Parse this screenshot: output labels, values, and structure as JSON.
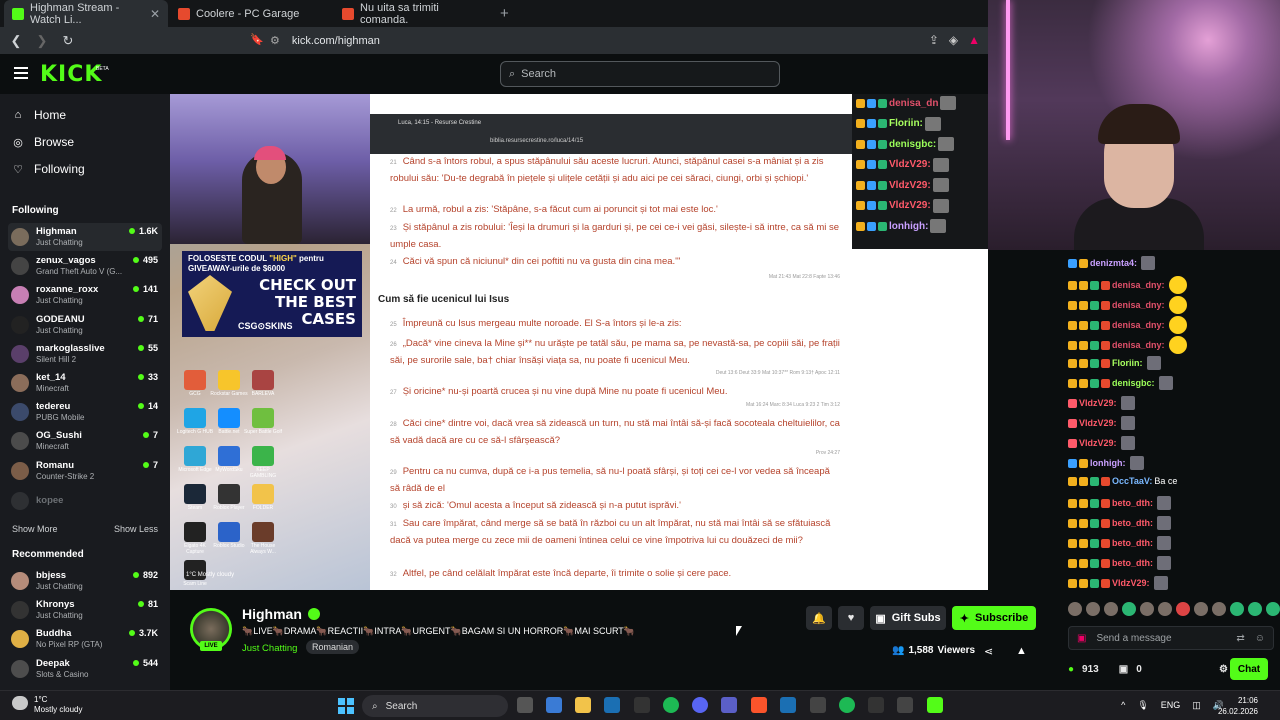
{
  "browser": {
    "tabs": [
      {
        "title": "Highman Stream - Watch Li...",
        "favicon_color": "#53fc18"
      },
      {
        "title": "Coolere - PC Garage",
        "favicon_color": "#e64a2e"
      },
      {
        "title": "Nu uita sa trimiti comanda.",
        "favicon_color": "#e64a2e"
      }
    ],
    "url": "kick.com/highman"
  },
  "kick": {
    "logo": "KICK",
    "beta": "BETA",
    "search_placeholder": "Search"
  },
  "sidebar": {
    "nav": [
      {
        "label": "Home",
        "icon": "home-icon"
      },
      {
        "label": "Browse",
        "icon": "compass-icon"
      },
      {
        "label": "Following",
        "icon": "heart-icon"
      }
    ],
    "following_title": "Following",
    "following": [
      {
        "name": "Highman",
        "game": "Just Chatting",
        "viewers": "1.6K",
        "color": "#7a6c5c"
      },
      {
        "name": "zenux_vagos",
        "game": "Grand Theft Auto V (G...",
        "viewers": "495",
        "color": "#444"
      },
      {
        "name": "roxanne_roxx",
        "game": "Just Chatting",
        "viewers": "141",
        "color": "#c77fb4"
      },
      {
        "name": "GODEANU",
        "game": "Just Chatting",
        "viewers": "71",
        "color": "#222"
      },
      {
        "name": "markoglasslive",
        "game": "Silent Hill 2",
        "viewers": "55",
        "color": "#5a3f6a"
      },
      {
        "name": "ket_14",
        "game": "Minecraft",
        "viewers": "33",
        "color": "#8b6d5a"
      },
      {
        "name": "tedereu",
        "game": "PUBG Mobile",
        "viewers": "14",
        "color": "#3b4a6b"
      },
      {
        "name": "OG_Sushi",
        "game": "Minecraft",
        "viewers": "7",
        "color": "#4b4b4b"
      },
      {
        "name": "Romanu",
        "game": "Counter-Strike 2",
        "viewers": "7",
        "color": "#7b5d48"
      }
    ],
    "offline": "kopee",
    "show_more": "Show More",
    "show_less": "Show Less",
    "recommended_title": "Recommended",
    "recommended": [
      {
        "name": "bbjess",
        "game": "Just Chatting",
        "viewers": "892",
        "color": "#b58c7a"
      },
      {
        "name": "Khronys",
        "game": "Just Chatting",
        "viewers": "81",
        "color": "#333"
      },
      {
        "name": "Buddha",
        "game": "No Pixel RP (GTA)",
        "viewers": "3.7K",
        "color": "#e0b045"
      },
      {
        "name": "Deepak",
        "game": "Slots & Casino",
        "viewers": "544",
        "color": "#4d4d4d"
      }
    ]
  },
  "player": {
    "promo": {
      "line1": "FOLOSESTE CODUL ",
      "code": "\"HIGH\"",
      "line1b": " pentru",
      "line2": "GIVEAWAY-urile de $6000",
      "cta": "CHECK OUT THE BEST CASES",
      "brand": "CSG⊙SKINS"
    },
    "desktop_icons": [
      {
        "label": "GCG",
        "color": "#e25d3a"
      },
      {
        "label": "Rockstar Games",
        "color": "#f7c52b"
      },
      {
        "label": "BARLEVA",
        "color": "#a94442"
      },
      {
        "label": "Logitech G HUB",
        "color": "#1fa5e5"
      },
      {
        "label": "Battle.net",
        "color": "#148eff"
      },
      {
        "label": "Super Battle Golf",
        "color": "#6fbf3f"
      },
      {
        "label": "Microsoft Edge",
        "color": "#2fa7d6"
      },
      {
        "label": "MyWordSku",
        "color": "#2f6fd6"
      },
      {
        "label": "KEEP GAMBLING",
        "color": "#3bb44a"
      },
      {
        "label": "Steam",
        "color": "#1b2838"
      },
      {
        "label": "Roblox Player",
        "color": "#333"
      },
      {
        "label": "FOLDER",
        "color": "#f2c34a"
      },
      {
        "label": "Elgato 4K Capture",
        "color": "#222"
      },
      {
        "label": "Roblox Studio",
        "color": "#2b63c9"
      },
      {
        "label": "The House Always W...",
        "color": "#6a3c2a"
      },
      {
        "label": "Scam Line",
        "color": "#222"
      }
    ],
    "desktop_weather": "1°C Mostly cloudy",
    "bible": {
      "tab": "Luca, 14:15 - Resurse Crestine",
      "url": "biblia.resursecrestine.ro/luca/14/15",
      "lines": [
        {
          "n": "21",
          "t": "Când s-a întors robul, a spus stăpânului său aceste lucruri. Atunci, stăpânul casei s-a mâniat și a zis robului său: 'Du-te degrabă în piețele și ulițele cetății și adu aici pe cei săraci, ciungi, orbi și șchiopi.'"
        },
        {
          "n": "22",
          "t": "La urmă, robul a zis: 'Stăpâne, s-a făcut cum ai poruncit și tot mai este loc.'"
        },
        {
          "n": "23",
          "t": "Și stăpânul a zis robului: 'Îeși la drumuri și la garduri și, pe cei ce-i vei găsi, silește-i să intre, ca să mi se umple casa."
        },
        {
          "n": "24",
          "t": "Căci vă spun că niciunul* din cei poftiti nu va gusta din cina mea.'\""
        }
      ],
      "ref1": "Mat 21:43 Mat 22:8 Fapte 13:46",
      "heading": "Cum să fie ucenicul lui Isus",
      "lines2": [
        {
          "n": "25",
          "t": "Împreună cu Isus mergeau multe noroade. El S-a întors și le-a zis:"
        },
        {
          "n": "26",
          "t": "„Dacă* vine cineva la Mine și** nu urăște pe tatăl său, pe mama sa, pe nevastă-sa, pe copiii săi, pe frații săi, pe surorile sale, ba† chiar însăși viața sa, nu poate fi ucenicul Meu."
        },
        {
          "n": "27",
          "t": "Și oricine* nu-și poartă crucea și nu vine după Mine nu poate fi ucenicul Meu."
        },
        {
          "n": "28",
          "t": "Căci cine* dintre voi, dacă vrea să zidească un turn, nu stă mai întâi să-și facă socoteala cheltuielilor, ca să vadă dacă are cu ce să-l sfârșească?"
        },
        {
          "n": "29",
          "t": "Pentru ca nu cumva, după ce i-a pus temelia, să nu-l poată sfârși, și toți cei ce-l vor vedea să înceapă să râdă de el"
        },
        {
          "n": "30",
          "t": "și să zică: 'Omul acesta a început să zidească și n-a putut isprăvi.'"
        },
        {
          "n": "31",
          "t": "Sau care împărat, când merge să se bată în război cu un alt împărat, nu stă mai întâi să se sfătuiască dacă va putea merge cu zece mii de oameni întinea celui ce vine împotriva lui cu douăzeci de mii?"
        },
        {
          "n": "32",
          "t": "Altfel, pe când celălalt împărat este încă departe, îi trimite o solie și cere pace."
        }
      ],
      "refs2": [
        "Deut 13:6 Deut 33:9 Mat 10:37** Rom 9:13† Apoc 12:11",
        "Mat 16:24 Marc 8:34 Luca 9:23 2 Tim 3:12",
        "Prov 24:27"
      ]
    },
    "overlay_chat": [
      {
        "name": "denisa_dn",
        "color": "#e0506a"
      },
      {
        "name": "Floriin:",
        "color": "#a8ff60"
      },
      {
        "name": "denisgbc:",
        "color": "#9cff5a"
      },
      {
        "name": "VldzV29:",
        "color": "#ff5a6a"
      },
      {
        "name": "VldzV29:",
        "color": "#ff5a6a"
      },
      {
        "name": "VldzV29:",
        "color": "#ff5a6a"
      },
      {
        "name": "lonhigh:",
        "color": "#c9a0ff"
      }
    ]
  },
  "stream": {
    "name": "Highman",
    "live": "LIVE",
    "title": "🐂LIVE🐂DRAMA🐂REACTII🐂INTRA🐂URGENT🐂BAGAM SI UN HORROR🐂MAI SCURT🐂",
    "category": "Just Chatting",
    "language": "Romanian",
    "gift_subs": "Gift Subs",
    "subscribe": "Subscribe",
    "viewers": "1,588",
    "viewers_label": "Viewers"
  },
  "chat": {
    "messages": [
      {
        "name": "denizmta4:",
        "color": "#c9a0ff",
        "msg": ""
      },
      {
        "name": "denisa_dny:",
        "color": "#e0506a",
        "msg": ""
      },
      {
        "name": "denisa_dny:",
        "color": "#e0506a",
        "msg": ""
      },
      {
        "name": "denisa_dny:",
        "color": "#e0506a",
        "msg": ""
      },
      {
        "name": "denisa_dny:",
        "color": "#e0506a",
        "msg": ""
      },
      {
        "name": "Floriin:",
        "color": "#a8ff60",
        "msg": ""
      },
      {
        "name": "denisgbc:",
        "color": "#9cff5a",
        "msg": ""
      },
      {
        "name": "VldzV29:",
        "color": "#ff5a6a",
        "msg": ""
      },
      {
        "name": "VldzV29:",
        "color": "#ff5a6a",
        "msg": ""
      },
      {
        "name": "VldzV29:",
        "color": "#ff5a6a",
        "msg": ""
      },
      {
        "name": "lonhigh:",
        "color": "#c9a0ff",
        "msg": ""
      },
      {
        "name": "OccTaaV:",
        "color": "#7ab8ff",
        "msg": "Ba ce"
      },
      {
        "name": "beto_dth:",
        "color": "#ff5a6a",
        "msg": ""
      },
      {
        "name": "beto_dth:",
        "color": "#ff5a6a",
        "msg": ""
      },
      {
        "name": "beto_dth:",
        "color": "#ff5a6a",
        "msg": ""
      },
      {
        "name": "beto_dth:",
        "color": "#ff5a6a",
        "msg": ""
      },
      {
        "name": "VldzV29:",
        "color": "#ff5a6a",
        "msg": ""
      }
    ],
    "input_placeholder": "Send a message",
    "points": "913",
    "gifts": "0",
    "chat_button": "Chat"
  },
  "taskbar": {
    "weather_temp": "1°C",
    "weather_desc": "Mostly cloudy",
    "search": "Search",
    "lang": "ENG",
    "time": "21:06",
    "date": "26.02.2026"
  }
}
